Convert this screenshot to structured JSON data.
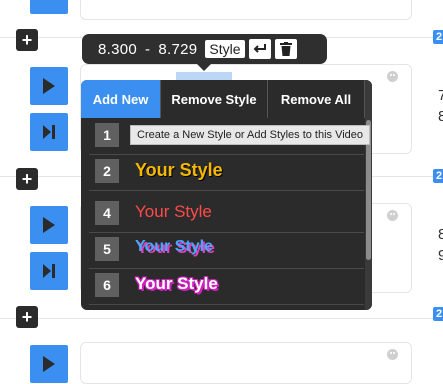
{
  "tooltip": {
    "time_start": "8.300",
    "time_sep": "-",
    "time_end": "8.729",
    "style_label": "Style"
  },
  "style_panel": {
    "tabs": [
      "Add New",
      "Remove Style",
      "Remove All"
    ],
    "hint": "Create a New Style or Add Styles to this Video",
    "rows": [
      {
        "number": "1",
        "label": ""
      },
      {
        "number": "2",
        "label": "Your Style"
      },
      {
        "number": "4",
        "label": "Your Style"
      },
      {
        "number": "5",
        "label": "Your Style"
      },
      {
        "number": "6",
        "label": "Your Style"
      }
    ]
  },
  "right_edge": {
    "badges": [
      "2",
      "2",
      "2"
    ],
    "digits": [
      "7",
      "8",
      "8",
      "9"
    ]
  },
  "controls": {
    "plus": "+",
    "play_icon": "play-icon",
    "skip_icon": "skip-next-icon"
  },
  "colors": {
    "accent": "#3a8ff0",
    "dark": "#2b2b2b",
    "style2": "#f5b800",
    "style4": "#ff4a4a",
    "style5": "#4aa8ff",
    "style6": "#ffffff"
  }
}
